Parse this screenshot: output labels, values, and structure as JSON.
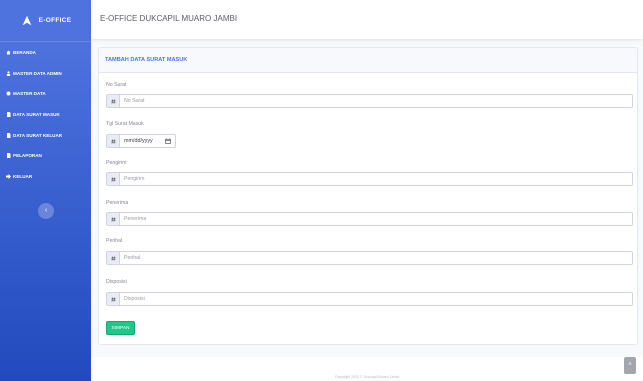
{
  "brand": {
    "name": "E-OFFICE",
    "icon": "rocket-icon"
  },
  "sidebar": {
    "items": [
      {
        "label": "BERANDA",
        "icon": "home-icon"
      },
      {
        "label": "MASTER DATA ADMIN",
        "icon": "user-icon"
      },
      {
        "label": "MASTER DATA",
        "icon": "database-icon"
      },
      {
        "label": "DATA SURAT MASUK",
        "icon": "file-icon"
      },
      {
        "label": "DATA SURAT KELUAR",
        "icon": "file-icon"
      },
      {
        "label": "PELAPORAN",
        "icon": "file-icon"
      },
      {
        "label": "KELUAR",
        "icon": "sign-out-icon"
      }
    ],
    "toggle_label": "‹"
  },
  "topbar": {
    "title": "E-OFFICE DUKCAPIL MUARO JAMBI"
  },
  "card": {
    "title": "TAMBAH DATA SURAT MASUK",
    "fields": [
      {
        "label": "No Surat",
        "placeholder": "No Surat"
      },
      {
        "label": "Tgl Surat Masuk",
        "value": "mm/dd/yyyy"
      },
      {
        "label": "Pengirim",
        "placeholder": "Pengirim"
      },
      {
        "label": "Penerima",
        "placeholder": "Penerima"
      },
      {
        "label": "Perihal",
        "placeholder": "Perihal"
      },
      {
        "label": "Disposisi",
        "placeholder": "Disposisi"
      }
    ],
    "submit_label": "SIMPAN"
  },
  "footer": {
    "text": "Copyright 2023 © Dukcapil Muaro Jambi"
  },
  "scroll_top_label": "˄",
  "colors": {
    "sidebar": "#4e73df",
    "accent": "#4e73df",
    "submit": "#1cc88a"
  }
}
